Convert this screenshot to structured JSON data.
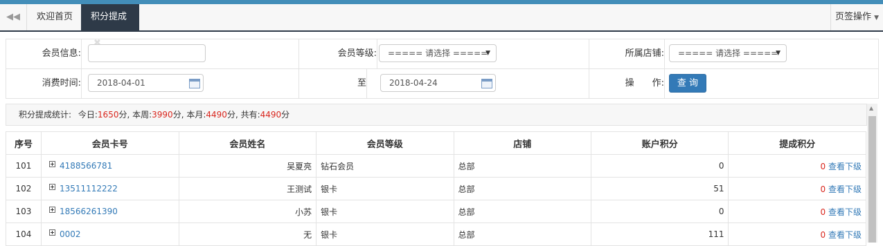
{
  "tabs": {
    "back_icon": "double-chevron-left-icon",
    "home": "欢迎首页",
    "active": "积分提成",
    "close_glyph": "✖",
    "ops": "页签操作"
  },
  "form": {
    "member_info_label": "会员信息:",
    "member_info_value": "",
    "member_level_label": "会员等级:",
    "member_level_value": "===== 请选择 =====",
    "store_label": "所属店铺:",
    "store_value": "===== 请选择 =====",
    "time_label": "消费时间:",
    "date_from": "2018-04-01",
    "to_label": "至",
    "date_to": "2018-04-24",
    "op_label": "操　　作:",
    "query_button": "查 询"
  },
  "stats": {
    "label": "积分提成统计:",
    "today_label": "今日:",
    "today_value": "1650",
    "unit1": "分, 本周:",
    "week_value": "3990",
    "unit2": "分, 本月:",
    "month_value": "4490",
    "unit3": "分, 共有:",
    "total_value": "4490",
    "unit4": "分"
  },
  "table": {
    "headers": [
      "序号",
      "会员卡号",
      "会员姓名",
      "会员等级",
      "店铺",
      "账户积分",
      "提成积分"
    ],
    "view_label": "查看下级",
    "rows": [
      {
        "no": "101",
        "card": "4188566781",
        "name": "吴夏亮",
        "level": "钻石会员",
        "store": "总部",
        "points": "0",
        "commission": "0"
      },
      {
        "no": "102",
        "card": "13511112222",
        "name": "王测试",
        "level": "银卡",
        "store": "总部",
        "points": "51",
        "commission": "0"
      },
      {
        "no": "103",
        "card": "18566261390",
        "name": "小苏",
        "level": "银卡",
        "store": "总部",
        "points": "0",
        "commission": "0"
      },
      {
        "no": "104",
        "card": "0002",
        "name": "无",
        "level": "银卡",
        "store": "总部",
        "points": "111",
        "commission": "0"
      }
    ]
  },
  "colors": {
    "accent": "#438eb9",
    "tab_active": "#2e3a48",
    "button": "#337ab7",
    "highlight": "#d9251c"
  }
}
